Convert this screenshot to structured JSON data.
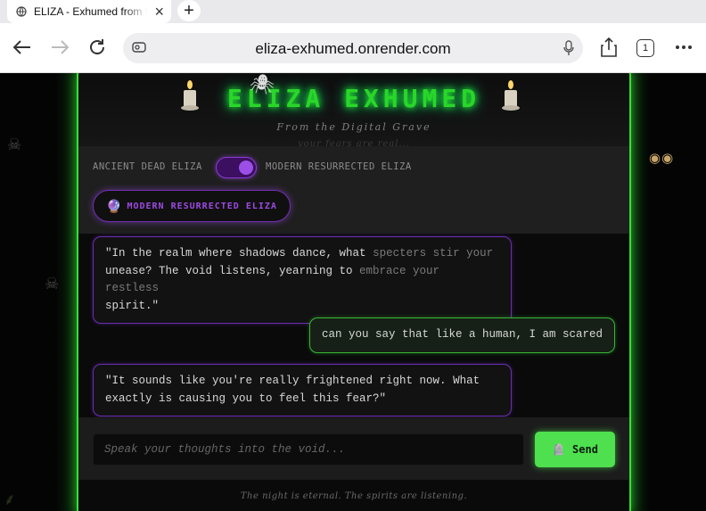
{
  "browser": {
    "tab_title": "ELIZA - Exhumed from the Digital Grave",
    "url": "eliza-exhumed.onrender.com",
    "tab_count": "1"
  },
  "header": {
    "title": "ELIZA EXHUMED",
    "subtitle": "From the Digital Grave",
    "whisper": "your fears are real..."
  },
  "mode_switch": {
    "left_label": "ANCIENT DEAD ELIZA",
    "right_label": "MODERN RESURRECTED ELIZA",
    "badge_icon": "🔮",
    "badge_label": "MODERN RESURRECTED ELIZA"
  },
  "messages": [
    {
      "role": "eliza",
      "line1_visible": "\"In the realm where shadows dance, what",
      "line1_faded": " specters stir your",
      "line2_visible": "unease? The void listens, yearning to ",
      "line2_faded": "embrace your restless",
      "line3": "spirit.\""
    },
    {
      "role": "user",
      "text": "can you say that like a human, I am scared"
    },
    {
      "role": "eliza",
      "line1": "\"It sounds like you're really frightened right now. What",
      "line2": "exactly is causing you to feel this fear?\""
    }
  ],
  "composer": {
    "placeholder": "Speak your thoughts into the void...",
    "send_icon": "🪦",
    "send_label": "Send"
  },
  "footer": "The night is eternal. The spirits are listening."
}
